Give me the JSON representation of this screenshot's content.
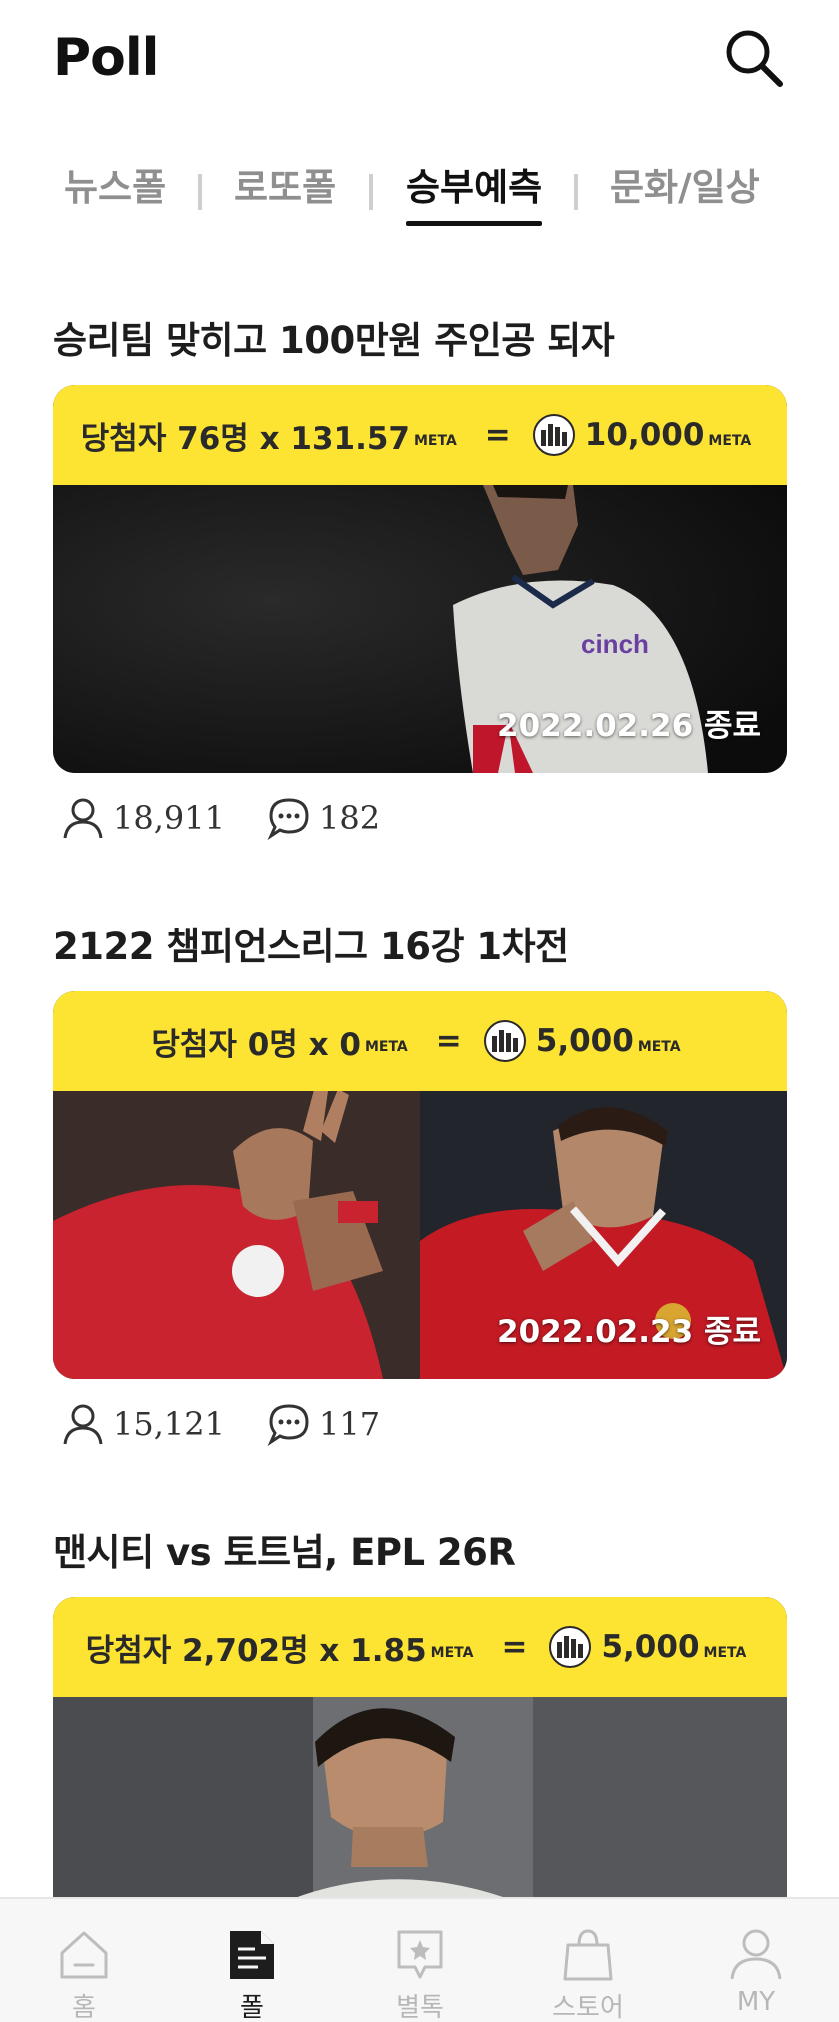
{
  "header": {
    "title": "Poll",
    "search_icon": "search-icon"
  },
  "tabs": [
    {
      "label": "뉴스폴",
      "active": false
    },
    {
      "label": "로또폴",
      "active": false
    },
    {
      "label": "승부예측",
      "active": true
    },
    {
      "label": "문화/일상",
      "active": false
    }
  ],
  "polls": [
    {
      "title": "승리팀 맞히고 100만원 주인공 되자",
      "winners": "당첨자 76명 x 131.57",
      "unit": "META",
      "equals": "=",
      "total": "10,000",
      "end_date": "2022.02.26 종료",
      "participants": "18,911",
      "comments": "182"
    },
    {
      "title": "2122 챔피언스리그 16강 1차전",
      "winners": "당첨자 0명 x 0",
      "unit": "META",
      "equals": "=",
      "total": "5,000",
      "end_date": "2022.02.23 종료",
      "participants": "15,121",
      "comments": "117"
    },
    {
      "title": "맨시티 vs 토트넘, EPL 26R",
      "winners": "당첨자 2,702명 x 1.85",
      "unit": "META",
      "equals": "=",
      "total": "5,000",
      "end_date": "",
      "participants": "",
      "comments": ""
    }
  ],
  "bottom_nav": [
    {
      "label": "홈",
      "icon": "home-icon",
      "active": false
    },
    {
      "label": "폴",
      "icon": "poll-icon",
      "active": true
    },
    {
      "label": "별톡",
      "icon": "star-chat-icon",
      "active": false
    },
    {
      "label": "스토어",
      "icon": "shopping-bag-icon",
      "active": false
    },
    {
      "label": "MY",
      "icon": "user-icon",
      "active": false
    }
  ],
  "colors": {
    "accent": "#fde432",
    "text": "#1a1a1a",
    "inactive": "#8f8f8f"
  }
}
